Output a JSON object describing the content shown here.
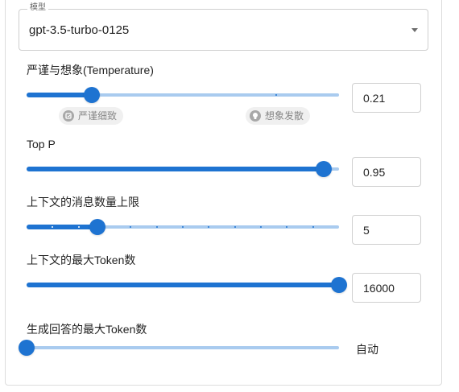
{
  "model": {
    "legend": "模型",
    "value": "gpt-3.5-turbo-0125"
  },
  "temperature": {
    "label": "严谨与想象(Temperature)",
    "value": "0.21",
    "fraction": 0.21,
    "hint_left": "严谨细致",
    "hint_right": "想象发散"
  },
  "top_p": {
    "label": "Top P",
    "value": "0.95",
    "fraction": 0.95
  },
  "context_limit": {
    "label": "上下文的消息数量上限",
    "value": "5",
    "fraction": 0.227
  },
  "context_tokens": {
    "label": "上下文的最大Token数",
    "value": "16000",
    "fraction": 1.0
  },
  "reply_tokens": {
    "label": "生成回答的最大Token数",
    "value": "自动",
    "fraction": 0.0
  },
  "colors": {
    "accent": "#1e73d1",
    "track": "#a9cbef"
  }
}
